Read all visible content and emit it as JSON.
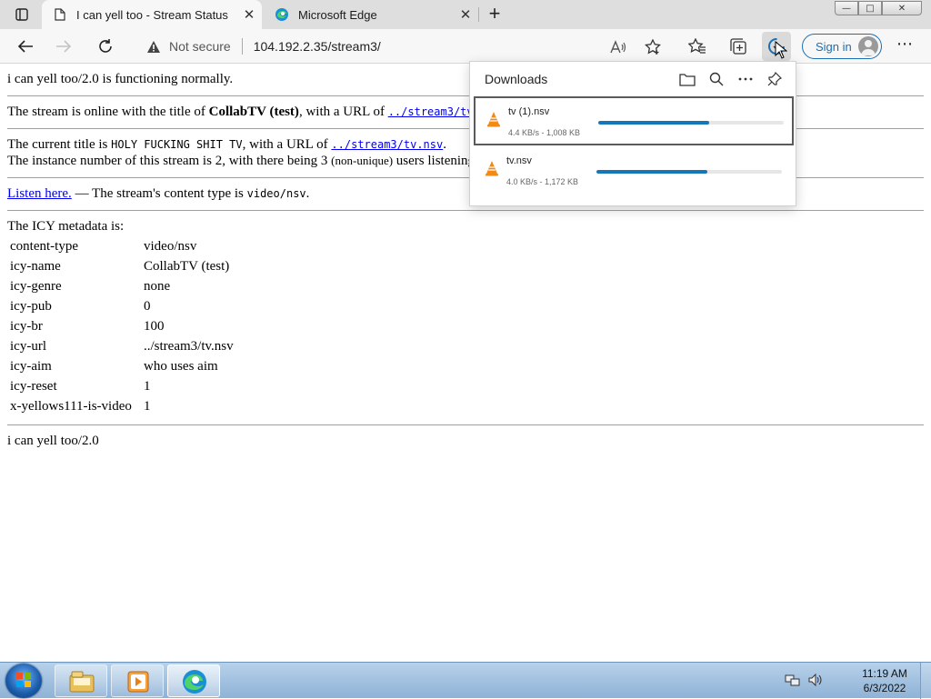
{
  "browser": {
    "tabs": [
      {
        "title": "I can yell too - Stream Status",
        "active": true
      },
      {
        "title": "Microsoft Edge",
        "active": false
      }
    ],
    "new_tab_label": "+",
    "window_buttons": {
      "minimize": "—",
      "maximize": "□",
      "close": "✕"
    },
    "address": {
      "security_label": "Not secure",
      "url": "104.192.2.35/stream3/"
    },
    "signin_label": "Sign in",
    "more_label": "⋯"
  },
  "page": {
    "status_line": "i can yell too/2.0 is functioning normally.",
    "title_line": {
      "prefix": "The stream is online with the title of ",
      "title": "CollabTV (test)",
      "middle": ", with a URL of ",
      "url": "../stream3/tv.nsv"
    },
    "current_title_line": {
      "prefix": "The current title is ",
      "title": "HOLY FUCKING SHIT TV",
      "middle": ", with a URL of ",
      "url": "../stream3/tv.nsv",
      "suffix": "."
    },
    "instance_line": {
      "prefix": "The instance number of this stream is 2, with there being 3 ",
      "note": "(non-unique)",
      "suffix": " users listening."
    },
    "listen_line": {
      "link": "Listen here.",
      "middle": " — The stream's content type is ",
      "content_type": "video/nsv",
      "suffix": "."
    },
    "icy_heading": "The ICY metadata is:",
    "icy_metadata": [
      {
        "key": "content-type",
        "value": "video/nsv"
      },
      {
        "key": "icy-name",
        "value": "CollabTV (test)"
      },
      {
        "key": "icy-genre",
        "value": "none"
      },
      {
        "key": "icy-pub",
        "value": "0"
      },
      {
        "key": "icy-br",
        "value": "100"
      },
      {
        "key": "icy-url",
        "value": "../stream3/tv.nsv"
      },
      {
        "key": "icy-aim",
        "value": "who uses aim"
      },
      {
        "key": "icy-reset",
        "value": "1"
      },
      {
        "key": "x-yellows111-is-video",
        "value": "1"
      }
    ],
    "footer": "i can yell too/2.0"
  },
  "downloads": {
    "title": "Downloads",
    "items": [
      {
        "name": "tv (1).nsv",
        "status": "4.4 KB/s - 1,008 KB",
        "progress": 0.6,
        "selected": true
      },
      {
        "name": "tv.nsv",
        "status": "4.0 KB/s - 1,172 KB",
        "progress": 0.6,
        "selected": false
      }
    ]
  },
  "taskbar": {
    "apps": [
      "windows-explorer",
      "media-player",
      "microsoft-edge"
    ],
    "clock": {
      "time": "11:19 AM",
      "date": "6/3/2022"
    }
  },
  "colors": {
    "link": "#0000ee",
    "progress": "#1677b8",
    "signin": "#1a6fb5"
  }
}
